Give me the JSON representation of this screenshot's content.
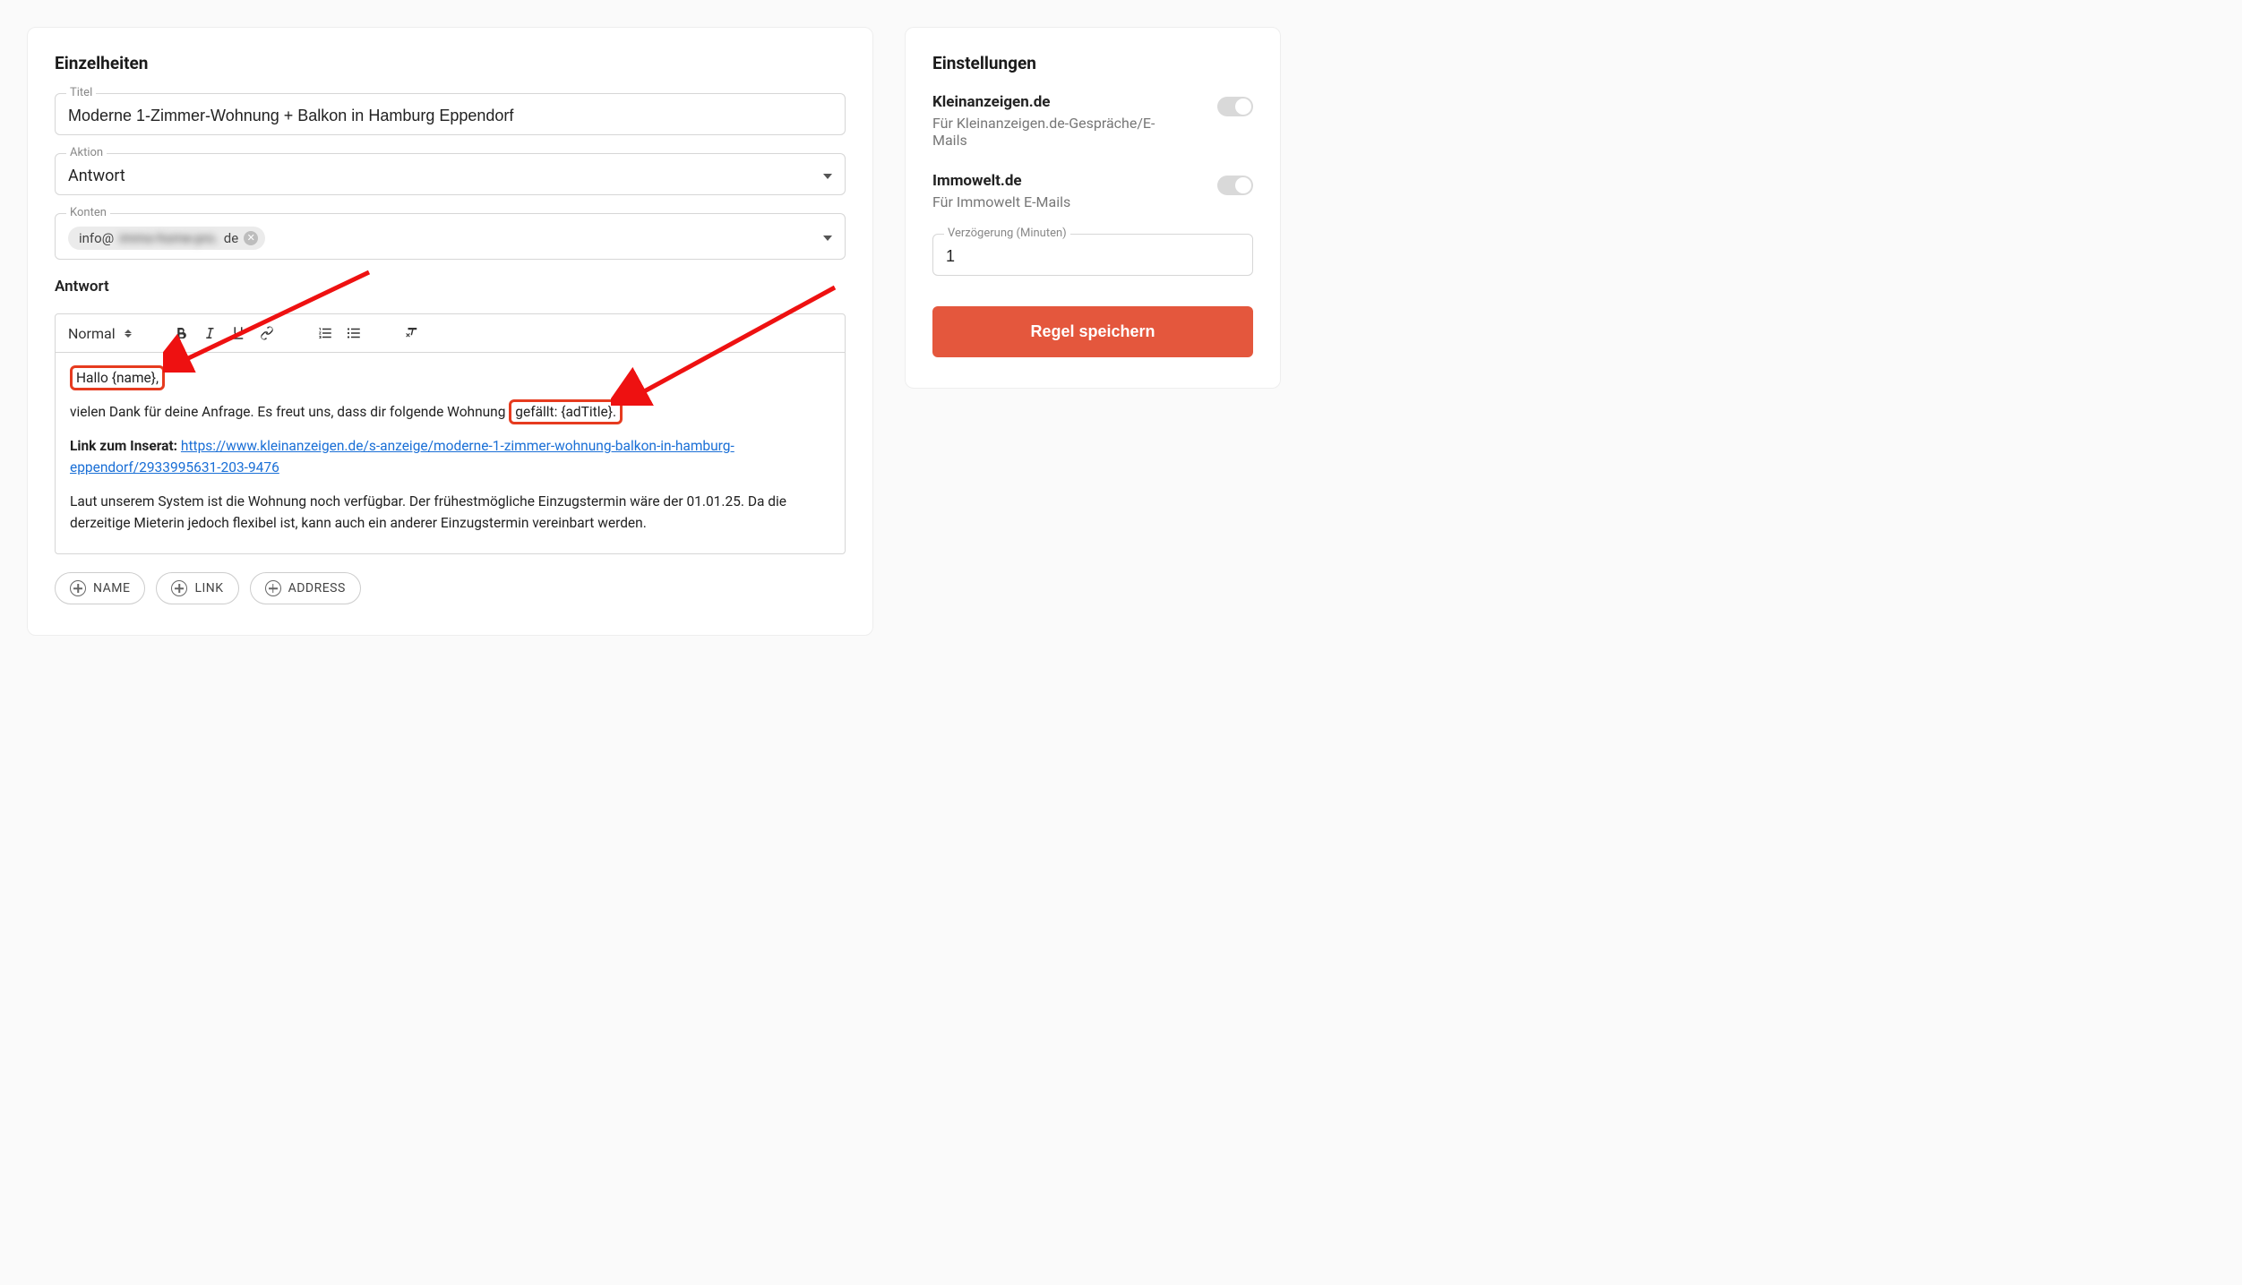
{
  "details": {
    "heading": "Einzelheiten",
    "title_label": "Titel",
    "title_value": "Moderne 1-Zimmer-Wohnung + Balkon in Hamburg Eppendorf",
    "action_label": "Aktion",
    "action_value": "Antwort",
    "accounts_label": "Konten",
    "account_chip_prefix": "info@",
    "account_chip_blur": "immo-home-pro.",
    "account_chip_suffix": "de"
  },
  "answer": {
    "label": "Antwort",
    "format": "Normal",
    "greeting": "Hallo {name},",
    "thanks_pre": "vielen Dank für deine Anfrage. Es freut uns, dass dir folgende Wohnung ",
    "thanks_hl": "gefällt: {adTitle}.",
    "link_label": "Link zum Inserat: ",
    "link_url": "https://www.kleinanzeigen.de/s-anzeige/moderne-1-zimmer-wohnung-balkon-in-hamburg-eppendorf/2933995631-203-9476",
    "para3": "Laut unserem System ist die Wohnung noch verfügbar. Der frühestmögliche Einzugstermin wäre der 01.01.25. Da die derzeitige Mieterin jedoch flexibel ist, kann auch ein anderer Einzugstermin vereinbart werden."
  },
  "pills": {
    "name": "NAME",
    "link": "LINK",
    "address": "ADDRESS"
  },
  "settings": {
    "heading": "Einstellungen",
    "k_title": "Kleinanzeigen.de",
    "k_desc": "Für Kleinanzeigen.de-Gespräche/E-Mails",
    "i_title": "Immowelt.de",
    "i_desc": "Für Immowelt E-Mails",
    "delay_label": "Verzögerung (Minuten)",
    "delay_value": "1",
    "save": "Regel speichern"
  }
}
